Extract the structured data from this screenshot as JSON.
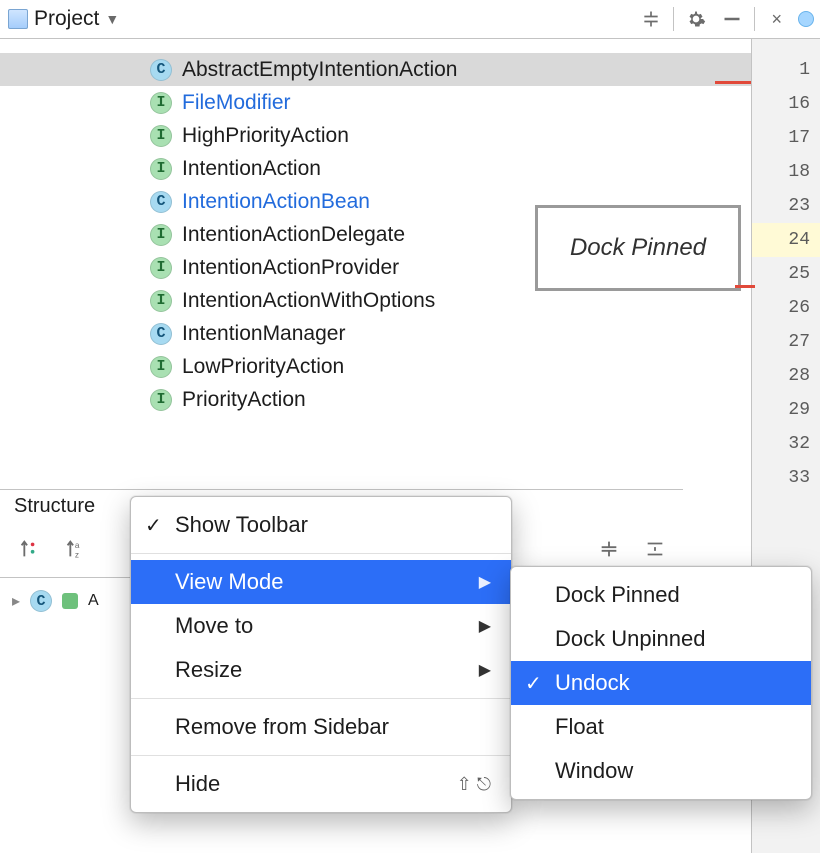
{
  "header": {
    "project_label": "Project",
    "gear_name": "gear-icon",
    "collapse_name": "collapse-icon",
    "minimize_name": "minimize-icon"
  },
  "tree": {
    "items": [
      {
        "badge": "c",
        "label": "AbstractEmptyIntentionAction",
        "link": false,
        "sel": true
      },
      {
        "badge": "i",
        "label": "FileModifier",
        "link": true,
        "sel": false
      },
      {
        "badge": "i",
        "label": "HighPriorityAction",
        "link": false,
        "sel": false
      },
      {
        "badge": "i",
        "label": "IntentionAction",
        "link": false,
        "sel": false
      },
      {
        "badge": "c",
        "label": "IntentionActionBean",
        "link": true,
        "sel": false
      },
      {
        "badge": "i",
        "label": "IntentionActionDelegate",
        "link": false,
        "sel": false
      },
      {
        "badge": "i",
        "label": "IntentionActionProvider",
        "link": false,
        "sel": false
      },
      {
        "badge": "i",
        "label": "IntentionActionWithOptions",
        "link": false,
        "sel": false
      },
      {
        "badge": "c",
        "label": "IntentionManager",
        "link": false,
        "sel": false
      },
      {
        "badge": "i",
        "label": "LowPriorityAction",
        "link": false,
        "sel": false
      },
      {
        "badge": "i",
        "label": "PriorityAction",
        "link": false,
        "sel": false
      }
    ]
  },
  "dock_label": "Dock Pinned",
  "gutter_lines": [
    {
      "n": "1"
    },
    {
      "n": "16"
    },
    {
      "n": "17"
    },
    {
      "n": "18"
    },
    {
      "n": "23"
    },
    {
      "n": "24",
      "hl": true
    },
    {
      "n": "25"
    },
    {
      "n": "26"
    },
    {
      "n": "27"
    },
    {
      "n": "28"
    },
    {
      "n": "29"
    },
    {
      "n": "32"
    },
    {
      "n": "33"
    }
  ],
  "structure": {
    "title": "Structure",
    "legend_label": "A"
  },
  "menu": {
    "items": [
      {
        "label": "Show Toolbar",
        "checked": true
      },
      {
        "sep": true
      },
      {
        "label": "View Mode",
        "submenu": true,
        "hl": true
      },
      {
        "label": "Move to",
        "submenu": true
      },
      {
        "label": "Resize",
        "submenu": true
      },
      {
        "sep": true
      },
      {
        "label": "Remove from Sidebar"
      },
      {
        "sep": true
      },
      {
        "label": "Hide",
        "shortcut": "⇧ ⎋"
      }
    ],
    "sub": [
      {
        "label": "Dock Pinned"
      },
      {
        "label": "Dock Unpinned"
      },
      {
        "label": "Undock",
        "checked": true,
        "hl": true
      },
      {
        "label": "Float"
      },
      {
        "label": "Window"
      }
    ]
  }
}
